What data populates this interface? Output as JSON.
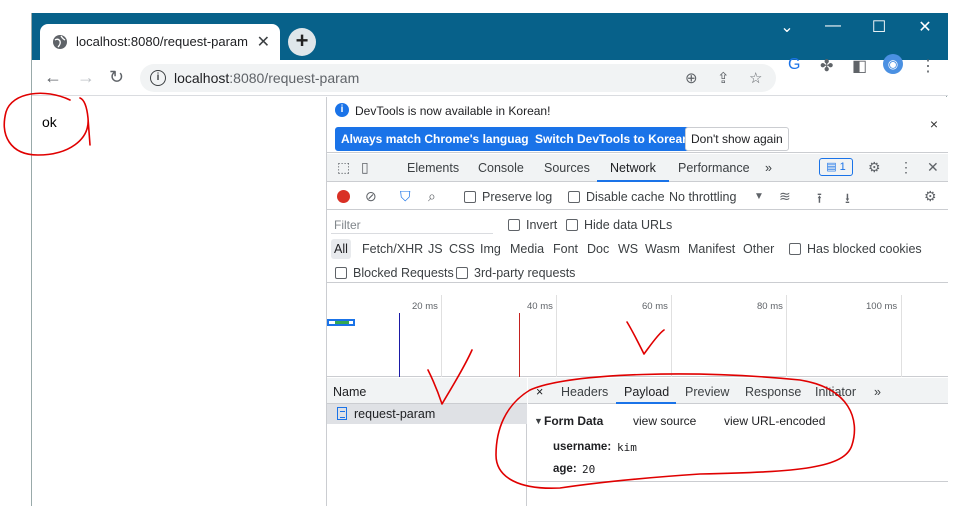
{
  "browser": {
    "tab_title": "localhost:8080/request-param",
    "tab_close": "✕",
    "new_tab": "+",
    "url_host": "localhost",
    "url_path": ":8080/request-param",
    "window_controls": {
      "minimize": "—",
      "maximize": "☐",
      "close": "✕",
      "dropdown": "⌄"
    }
  },
  "page": {
    "body_text": "ok"
  },
  "devtools": {
    "infobar": {
      "message": "DevTools is now available in Korean!",
      "btn_match": "Always match Chrome's language",
      "btn_switch": "Switch DevTools to Korean",
      "btn_dont_show": "Don't show again",
      "close": "×"
    },
    "panels": [
      "Elements",
      "Console",
      "Sources",
      "Network",
      "Performance"
    ],
    "more_panels": "»",
    "active_panel": "Network",
    "issues_badge": "1",
    "network_toolbar": {
      "preserve_log": "Preserve log",
      "disable_cache": "Disable cache",
      "throttling": "No throttling"
    },
    "filter": {
      "placeholder": "Filter",
      "invert": "Invert",
      "hide_data_urls": "Hide data URLs",
      "types": [
        "All",
        "Fetch/XHR",
        "JS",
        "CSS",
        "Img",
        "Media",
        "Font",
        "Doc",
        "WS",
        "Wasm",
        "Manifest",
        "Other"
      ],
      "has_blocked_cookies": "Has blocked cookies",
      "blocked_requests": "Blocked Requests",
      "third_party": "3rd-party requests"
    },
    "overview_ticks": [
      "20 ms",
      "40 ms",
      "60 ms",
      "80 ms",
      "100 ms"
    ],
    "requests": {
      "column_name": "Name",
      "rows": [
        {
          "name": "request-param"
        }
      ]
    },
    "details": {
      "close": "×",
      "tabs": [
        "Headers",
        "Payload",
        "Preview",
        "Response",
        "Initiator"
      ],
      "more": "»",
      "active_tab": "Payload",
      "form_data": {
        "title": "Form Data",
        "view_source": "view source",
        "view_url_encoded": "view URL-encoded",
        "fields": [
          {
            "key": "username:",
            "value": "kim"
          },
          {
            "key": "age:",
            "value": "20"
          }
        ]
      }
    }
  },
  "colors": {
    "titlebar": "#07618a",
    "accent": "#1a73e8",
    "annotation": "#e00000"
  }
}
